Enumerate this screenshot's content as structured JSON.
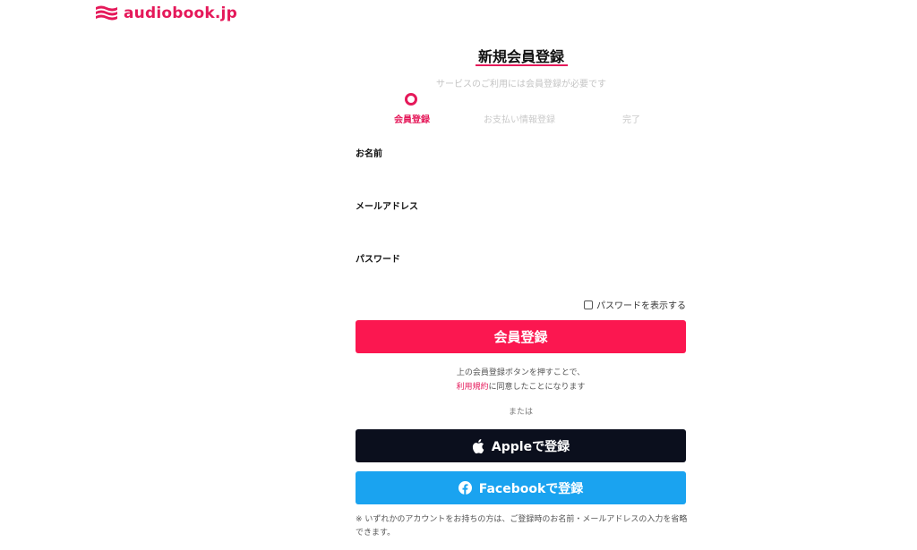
{
  "brand": {
    "name": "audiobook.jp",
    "color": "#e5195a",
    "icon": "waves-logo-icon"
  },
  "page": {
    "title": "新規会員登録",
    "subtitle": "サービスのご利用には会員登録が必要です"
  },
  "steps": [
    {
      "label": "会員登録",
      "active": true
    },
    {
      "label": "お支払い情報登録",
      "active": false
    },
    {
      "label": "完了",
      "active": false
    }
  ],
  "form": {
    "name_label": "お名前",
    "email_label": "メールアドレス",
    "password_label": "パスワード",
    "show_password_label": "パスワードを表示する",
    "show_password_checked": false
  },
  "buttons": {
    "register": "会員登録",
    "apple": "Appleで登録",
    "facebook": "Facebookで登録"
  },
  "terms": {
    "line1": "上の会員登録ボタンを押すことで、",
    "link": "利用規約",
    "line2": "に同意したことになります"
  },
  "or_text": "または",
  "note": "※ いずれかのアカウントをお持ちの方は、ご登録時のお名前・メールアドレスの入力を省略できます。",
  "colors": {
    "accent": "#e5195a",
    "register_button": "#fb1750",
    "apple_button": "#0b0f1d",
    "facebook_button": "#1aa3f0"
  }
}
